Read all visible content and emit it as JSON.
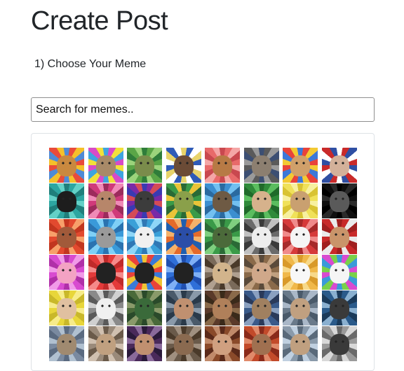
{
  "page": {
    "title": "Create Post"
  },
  "step": {
    "label": "1) Choose Your Meme"
  },
  "search": {
    "value": "",
    "placeholder": "Search for memes.."
  },
  "memes": [
    {
      "name": "meme-thumb-dog",
      "c1": "#e84b3c",
      "c2": "#f5c02a",
      "c3": "#4f8ad6",
      "s": "#c9893f"
    },
    {
      "name": "meme-thumb-horse",
      "c1": "#d84bc7",
      "c2": "#f2e03a",
      "c3": "#3fa4e0",
      "s": "#a88a68"
    },
    {
      "name": "meme-thumb-yoda",
      "c1": "#5aa547",
      "c2": "#9bd37b",
      "c3": "#2f7d3a",
      "s": "#7a8c4b"
    },
    {
      "name": "meme-thumb-woman",
      "c1": "#2f5bb7",
      "c2": "#ffffff",
      "c3": "#e8d36a",
      "s": "#6b4b36"
    },
    {
      "name": "meme-thumb-cat",
      "c1": "#e86a6a",
      "c2": "#f4a6a6",
      "c3": "#c9484f",
      "s": "#b77a45"
    },
    {
      "name": "meme-thumb-grumpy",
      "c1": "#5a5a5a",
      "c2": "#9a9a9a",
      "c3": "#3c4f73",
      "s": "#8c7f70"
    },
    {
      "name": "meme-thumb-kitten",
      "c1": "#e8433a",
      "c2": "#f3c933",
      "c3": "#3c78d8",
      "s": "#d0a06a"
    },
    {
      "name": "meme-thumb-news-anchor",
      "c1": "#c92a2a",
      "c2": "#2f4fa3",
      "c3": "#ffffff",
      "s": "#d3b19a"
    },
    {
      "name": "meme-thumb-business-cat",
      "c1": "#2da6a1",
      "c2": "#63d1c7",
      "c3": "#1f7f7b",
      "s": "#1d1d1d"
    },
    {
      "name": "meme-thumb-guy",
      "c1": "#d03a7a",
      "c2": "#f08ab7",
      "c3": "#9c2b5c",
      "s": "#b7866a"
    },
    {
      "name": "meme-thumb-birds",
      "c1": "#7a2aa6",
      "c2": "#d44b57",
      "c3": "#3a3ab2",
      "s": "#3c3c3c"
    },
    {
      "name": "meme-thumb-frog",
      "c1": "#3a9a48",
      "c2": "#e9c438",
      "c3": "#2a6a36",
      "s": "#8aa04a"
    },
    {
      "name": "meme-thumb-bird",
      "c1": "#3c8fd0",
      "c2": "#73c0f0",
      "c3": "#2a6aa0",
      "s": "#6e5a44"
    },
    {
      "name": "meme-thumb-man",
      "c1": "#2f8a3a",
      "c2": "#5bbd5f",
      "c3": "#1f6a2a",
      "s": "#d6b28c"
    },
    {
      "name": "meme-thumb-cat2",
      "c1": "#f0e15a",
      "c2": "#f7f0a0",
      "c3": "#d9c333",
      "s": "#c9a070"
    },
    {
      "name": "meme-thumb-dark",
      "c1": "#0f0f0f",
      "c2": "#2a2a2a",
      "c3": "#000000",
      "s": "#5a5a5a"
    },
    {
      "name": "meme-thumb-lady",
      "c1": "#e24a2f",
      "c2": "#f7a06a",
      "c3": "#c2361f",
      "s": "#a15a3a"
    },
    {
      "name": "meme-thumb-raccoon",
      "c1": "#3a9ad9",
      "c2": "#7fd0f6",
      "c3": "#2a73b0",
      "s": "#9a9a9a"
    },
    {
      "name": "meme-thumb-face",
      "c1": "#3aa0d8",
      "c2": "#8ed6f7",
      "c3": "#2f78b5",
      "s": "#f0f0f0"
    },
    {
      "name": "meme-thumb-parrot",
      "c1": "#e46a2a",
      "c2": "#f5b26a",
      "c3": "#1f5fb0",
      "s": "#2b4ea8"
    },
    {
      "name": "meme-thumb-raptor",
      "c1": "#3a9a48",
      "c2": "#7fcf7f",
      "c3": "#2a6a36",
      "s": "#4b6a3a"
    },
    {
      "name": "meme-thumb-panda",
      "c1": "#6a6a6a",
      "c2": "#c0c0c0",
      "c3": "#3a3a3a",
      "s": "#eeeeee"
    },
    {
      "name": "meme-thumb-rage",
      "c1": "#d63a3a",
      "c2": "#f08a8a",
      "c3": "#a72a2a",
      "s": "#f5f5f5"
    },
    {
      "name": "meme-thumb-woman2",
      "c1": "#c82a2a",
      "c2": "#eaeaea",
      "c3": "#a01f1f",
      "s": "#c9946a"
    },
    {
      "name": "meme-thumb-pony",
      "c1": "#d84bd0",
      "c2": "#f19ae8",
      "c3": "#b030a8",
      "s": "#f3a2c3"
    },
    {
      "name": "meme-thumb-penguin",
      "c1": "#e43a3a",
      "c2": "#f58a8a",
      "c3": "#c02a2a",
      "s": "#222222"
    },
    {
      "name": "meme-thumb-penguin2",
      "c1": "#e8433a",
      "c2": "#3a7ad8",
      "c3": "#f0c233",
      "s": "#222222"
    },
    {
      "name": "meme-thumb-penguin3",
      "c1": "#2f6fd8",
      "c2": "#7fb0f5",
      "c3": "#1f4fb0",
      "s": "#222222"
    },
    {
      "name": "meme-thumb-dog2",
      "c1": "#7a6a5a",
      "c2": "#b0a090",
      "c3": "#4a3a2a",
      "s": "#d2b48c"
    },
    {
      "name": "meme-thumb-man2",
      "c1": "#8a6a4a",
      "c2": "#c0a080",
      "c3": "#5a4a3a",
      "s": "#d0a88a"
    },
    {
      "name": "meme-thumb-goose",
      "c1": "#f0b84a",
      "c2": "#f7d98a",
      "c3": "#d99a2a",
      "s": "#f8f8f8"
    },
    {
      "name": "meme-thumb-troll",
      "c1": "#d84bd0",
      "c2": "#7ad04a",
      "c3": "#3a9ad9",
      "s": "#f5f5f5"
    },
    {
      "name": "meme-thumb-girl",
      "c1": "#e8d63a",
      "c2": "#f7ec8a",
      "c3": "#c9b82a",
      "s": "#e0c0a0"
    },
    {
      "name": "meme-thumb-face2",
      "c1": "#8a8a8a",
      "c2": "#d0d0d0",
      "c3": "#5a5a5a",
      "s": "#f0f0f0"
    },
    {
      "name": "meme-thumb-duck",
      "c1": "#4a6a3a",
      "c2": "#8a9a6a",
      "c3": "#2a4a2a",
      "s": "#3a6a3a"
    },
    {
      "name": "meme-thumb-aliens",
      "c1": "#4a5a6a",
      "c2": "#8a9aaa",
      "c3": "#2a3a4a",
      "s": "#c09070"
    },
    {
      "name": "meme-thumb-guys",
      "c1": "#5a3a2a",
      "c2": "#8a6a4a",
      "c3": "#3a2a1a",
      "s": "#b0805a"
    },
    {
      "name": "meme-thumb-tv",
      "c1": "#3a5a8a",
      "c2": "#8aa0c0",
      "c3": "#2a3a5a",
      "s": "#a08060"
    },
    {
      "name": "meme-thumb-dance",
      "c1": "#6a7a8a",
      "c2": "#aab8c8",
      "c3": "#4a5a6a",
      "s": "#c0a080"
    },
    {
      "name": "meme-thumb-archer",
      "c1": "#2a5a8a",
      "c2": "#8ab0d0",
      "c3": "#1a3a5a",
      "s": "#3a3a3a"
    },
    {
      "name": "meme-thumb-seal",
      "c1": "#7a8aa0",
      "c2": "#b0c0d0",
      "c3": "#5a6a80",
      "s": "#a08a70"
    },
    {
      "name": "meme-thumb-baby",
      "c1": "#9a8a7a",
      "c2": "#d0c0b0",
      "c3": "#6a5a4a",
      "s": "#c0a080"
    },
    {
      "name": "meme-thumb-kid",
      "c1": "#4a2a5a",
      "c2": "#8a6a9a",
      "c3": "#2a1a3a",
      "s": "#c09070"
    },
    {
      "name": "meme-thumb-crowd",
      "c1": "#6a5a4a",
      "c2": "#a09080",
      "c3": "#4a3a2a",
      "s": "#8a6a50"
    },
    {
      "name": "meme-thumb-hands",
      "c1": "#8a4a2a",
      "c2": "#c08a6a",
      "c3": "#5a2a1a",
      "s": "#d0a080"
    },
    {
      "name": "meme-thumb-man3",
      "c1": "#c24a2a",
      "c2": "#e08a6a",
      "c3": "#8a2a1a",
      "s": "#a07050"
    },
    {
      "name": "meme-thumb-people",
      "c1": "#8a9aaa",
      "c2": "#c0d0e0",
      "c3": "#5a6a7a",
      "s": "#c0a080"
    },
    {
      "name": "meme-thumb-robot",
      "c1": "#9a9a9a",
      "c2": "#d8d8d8",
      "c3": "#6a6a6a",
      "s": "#3a3a3a"
    }
  ]
}
